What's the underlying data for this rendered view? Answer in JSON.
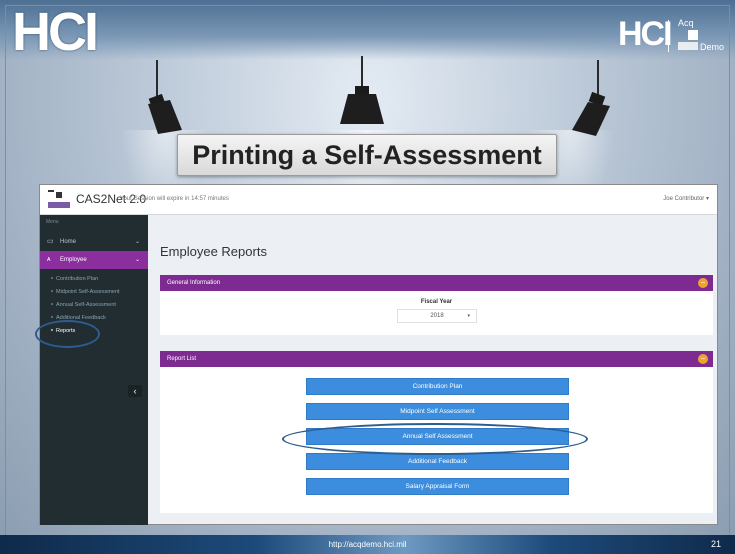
{
  "slide": {
    "logo_left": "HCI",
    "logo_right": "HCI",
    "acq_logo_top": "Acq",
    "acq_logo_bottom": "Demo",
    "title": "Printing a Self-Assessment",
    "footer_url": "http://acqdemo.hci.mil",
    "page_number": "21"
  },
  "app": {
    "name": "CAS2Net 2.0",
    "session_text": "Your Session will expire in 14:57 minutes",
    "user_menu": "Joe Contributor",
    "sidebar": {
      "menu_label": "Menu",
      "items": [
        {
          "label": "Home",
          "icon": "monitor-icon"
        },
        {
          "label": "Employee",
          "icon": "user-icon"
        }
      ],
      "subitems": [
        "Contribution Plan",
        "Midpoint Self-Assessment",
        "Annual Self-Assessment",
        "Additional Feedback",
        "Reports"
      ]
    },
    "page_heading": "Employee Reports",
    "general_panel": {
      "title": "General Information",
      "fiscal_year_label": "Fiscal Year",
      "fiscal_year_value": "2018"
    },
    "report_panel": {
      "title": "Report List",
      "buttons": [
        "Contribution Plan",
        "Midpoint Self Assessment",
        "Annual Self Assessment",
        "Additional Feedback",
        "Salary Appraisal Form"
      ]
    }
  },
  "colors": {
    "accent_purple": "#7d2a91",
    "button_blue": "#3c8dde",
    "sidebar_dark": "#222d32",
    "highlight_ellipse": "#2e5c8f"
  }
}
